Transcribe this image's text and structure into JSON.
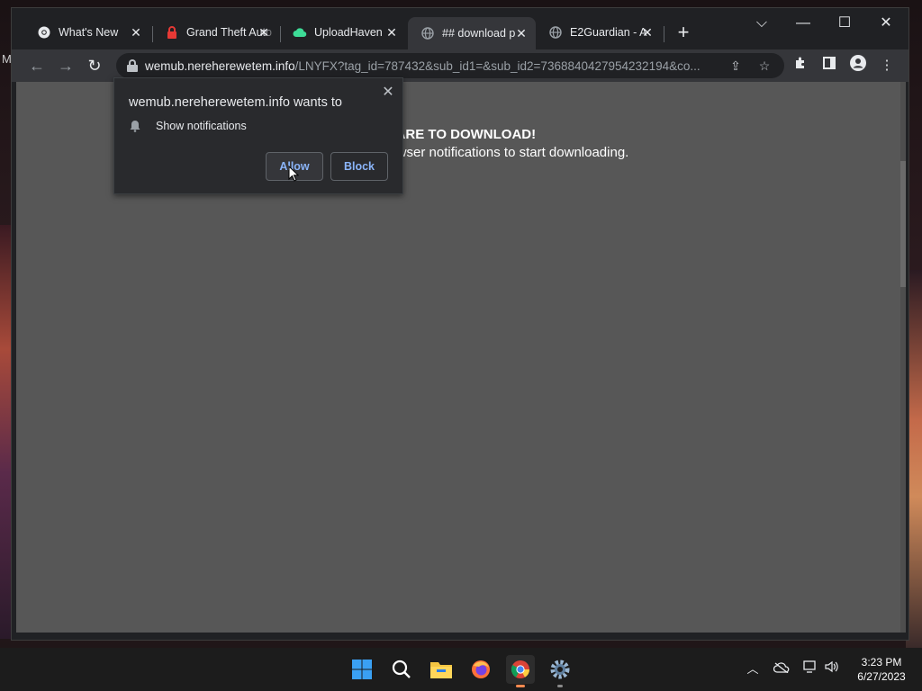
{
  "desktop": {
    "edge_text": "M"
  },
  "tabs": [
    {
      "title": "What's New",
      "icon": "chrome-icon",
      "active": false
    },
    {
      "title": "Grand Theft Auto",
      "icon": "red-lock-icon",
      "active": false
    },
    {
      "title": "UploadHaven",
      "icon": "cloud-icon",
      "active": false
    },
    {
      "title": "## download p",
      "icon": "globe-icon",
      "active": true
    },
    {
      "title": "E2Guardian - A",
      "icon": "globe-icon",
      "active": false
    }
  ],
  "toolbar": {
    "url_host": "wemub.nereherewetem.info",
    "url_path": "/LNYFX?tag_id=787432&sub_id1=&sub_id2=7368840427954232194&co..."
  },
  "page": {
    "heading": "## PREPARE TO DOWNLOAD!",
    "subtext": "Allow browser notifications to start downloading."
  },
  "permission_prompt": {
    "title": "wemub.nereherewetem.info wants to",
    "permission": "Show notifications",
    "allow_label": "Allow",
    "block_label": "Block"
  },
  "taskbar": {
    "apps": [
      "start",
      "search",
      "file-explorer",
      "firefox",
      "chrome",
      "settings"
    ],
    "time": "3:23 PM",
    "date": "6/27/2023"
  },
  "colors": {
    "page_bg": "#575757",
    "button_text": "#8ab4f8",
    "chrome_dark": "#202124"
  }
}
